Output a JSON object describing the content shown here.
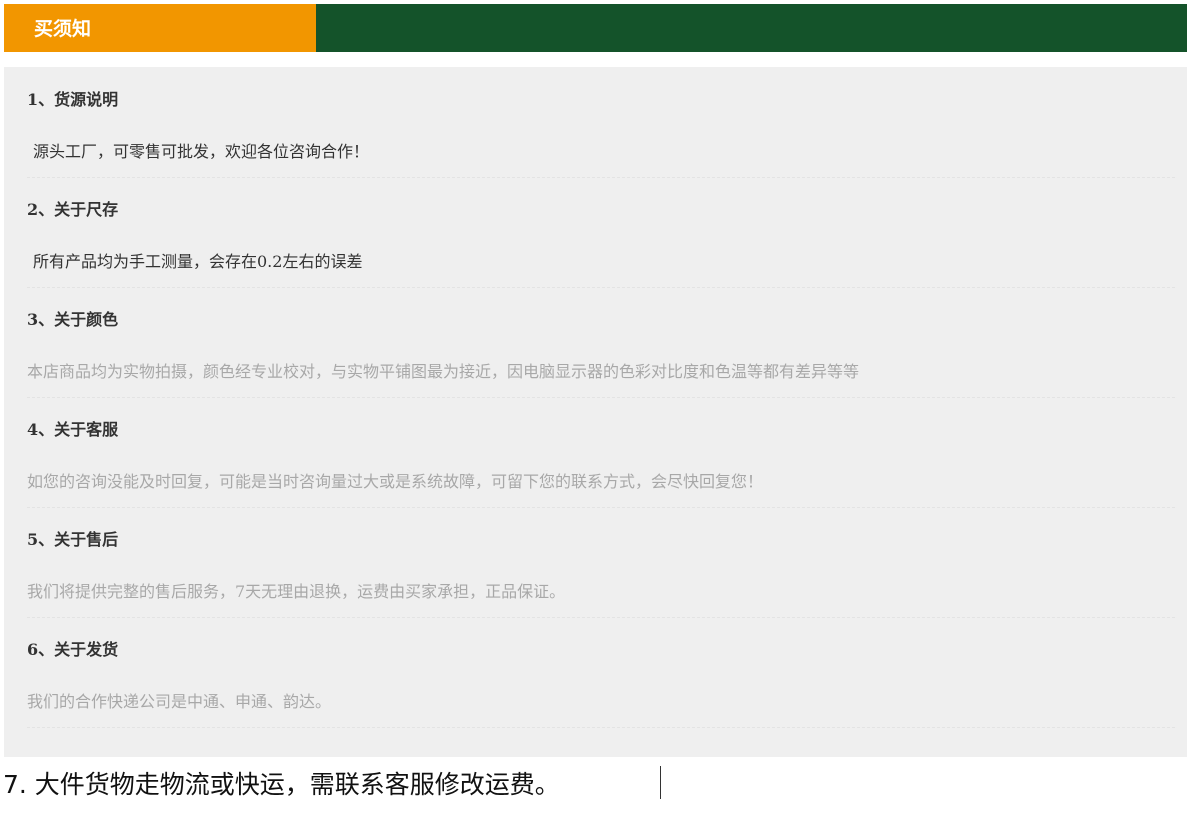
{
  "header": {
    "tab_label": "买须知",
    "colors": {
      "tab": "#f29600",
      "bar": "#14532a"
    }
  },
  "sections": [
    {
      "title": "1、货源说明",
      "body": "源头工厂，可零售可批发，欢迎各位咨询合作！"
    },
    {
      "title": "2、关于尺存",
      "body": "所有产品均为手工测量，会存在0.2左右的误差"
    },
    {
      "title": "3、关于颜色",
      "body": "本店商品均为实物拍摄，颜色经专业校对，与实物平铺图最为接近，因电脑显示器的色彩对比度和色温等都有差异等等"
    },
    {
      "title": "4、关于客服",
      "body": "如您的咨询没能及时回复，可能是当时咨询量过大或是系统故障，可留下您的联系方式，会尽快回复您！"
    },
    {
      "title": "5、关于售后",
      "body": "我们将提供完整的售后服务，7天无理由退换，运费由买家承担，正品保证。"
    },
    {
      "title": "6、关于发货",
      "body": "我们的合作快递公司是中通、申通、韵达。"
    }
  ],
  "footer": {
    "text": "7. 大件货物走物流或快运，需联系客服修改运费。"
  }
}
